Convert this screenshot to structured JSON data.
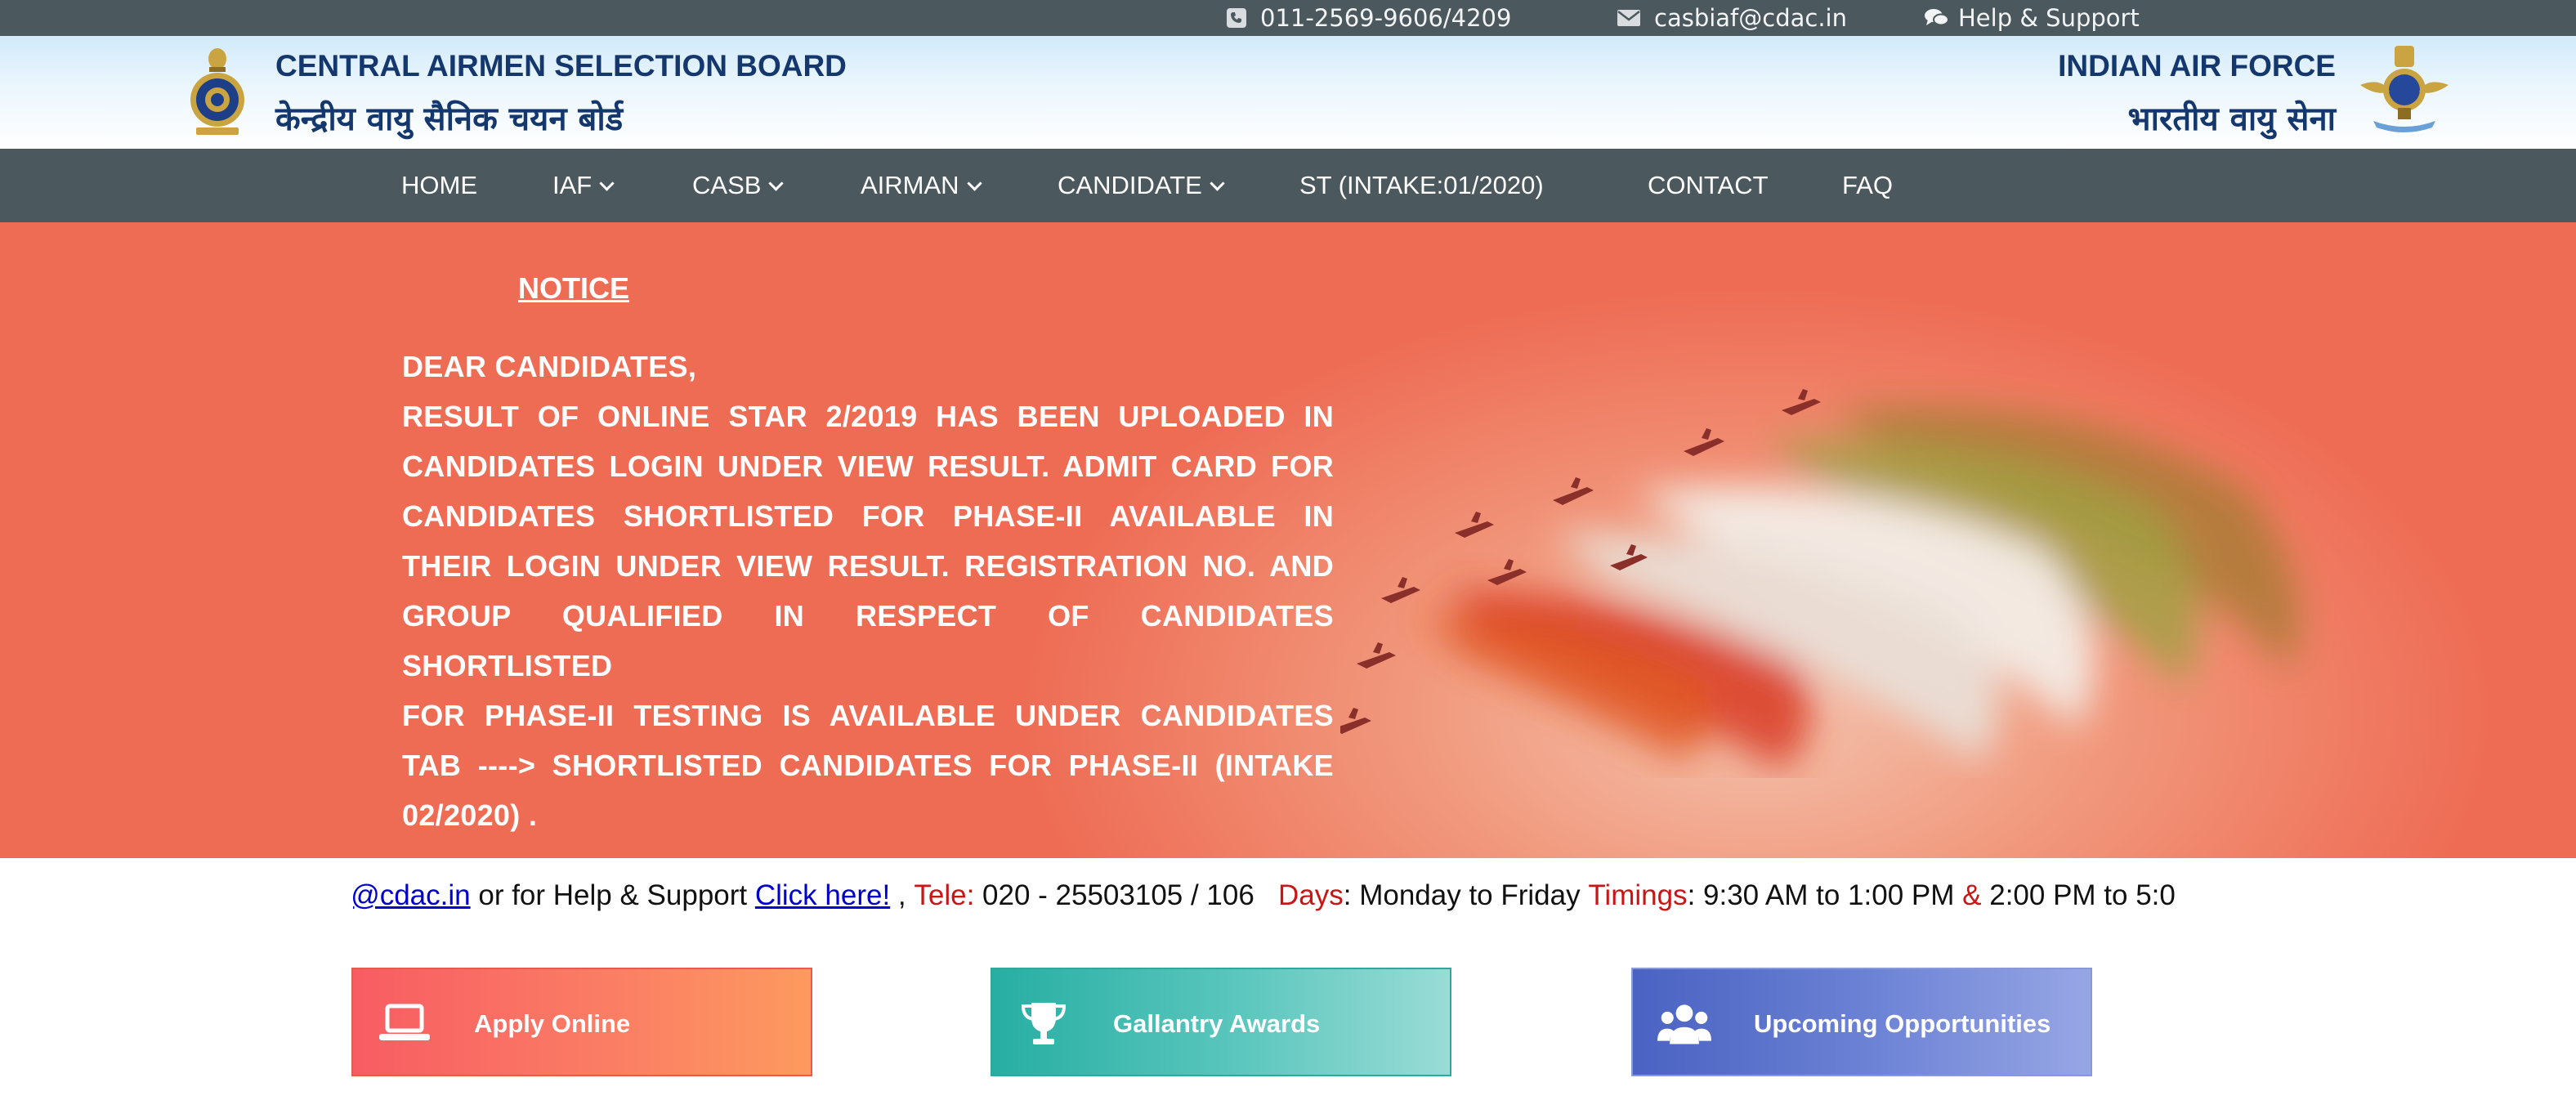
{
  "topbar": {
    "phone_icon": "phone-icon",
    "phone": "011-2569-9606/4209",
    "email_icon": "envelope-icon",
    "email": "casbiaf@cdac.in",
    "help_icon": "chat-bubbles-icon",
    "help": "Help & Support"
  },
  "header": {
    "org_en": "CENTRAL AIRMEN SELECTION BOARD",
    "org_hi": "केन्द्रीय वायु सैनिक चयन बोर्ड",
    "iaf_en": "INDIAN AIR FORCE",
    "iaf_hi": "भारतीय वायु सेना"
  },
  "nav": {
    "items": [
      {
        "label": "HOME",
        "dropdown": false
      },
      {
        "label": "IAF",
        "dropdown": true
      },
      {
        "label": "CASB",
        "dropdown": true
      },
      {
        "label": "AIRMAN",
        "dropdown": true
      },
      {
        "label": "CANDIDATE",
        "dropdown": true
      },
      {
        "label": "ST (INTAKE:01/2020)",
        "dropdown": false
      },
      {
        "label": "CONTACT",
        "dropdown": false
      },
      {
        "label": "FAQ",
        "dropdown": false
      }
    ]
  },
  "banner": {
    "notice_title": "NOTICE",
    "lines": [
      "DEAR CANDIDATES,",
      "RESULT OF ONLINE STAR 2/2019 HAS BEEN UPLOADED IN",
      "CANDIDATES LOGIN UNDER VIEW RESULT. ADMIT CARD FOR",
      "CANDIDATES SHORTLISTED FOR PHASE-II AVAILABLE IN",
      "THEIR LOGIN UNDER VIEW RESULT. REGISTRATION NO. AND",
      "GROUP QUALIFIED IN RESPECT OF CANDIDATES SHORTLISTED",
      "FOR PHASE-II TESTING IS AVAILABLE UNDER CANDIDATES",
      "TAB ----> SHORTLISTED CANDIDATES FOR PHASE-II (INTAKE",
      "02/2020) ."
    ]
  },
  "marquee": {
    "email_link": "af@cdac.in",
    "help_text": " or for Help & Support ",
    "click_link": "Click here!",
    "sep": " , ",
    "tele_label": "Tele:",
    "tele_value": " 020 - 25503105 / 106 ",
    "days_label": "Days",
    "days_value": ": Monday to Friday ",
    "timings_label": "Timings",
    "timings_value": ": 9:30 AM to 1:00 PM ",
    "amp": "&",
    "timings_value2": " 2:00 PM to 5:0"
  },
  "cards": [
    {
      "label": "Apply Online",
      "icon": "laptop-icon",
      "color": "#f85c63"
    },
    {
      "label": "Gallantry Awards",
      "icon": "trophy-icon",
      "color": "#27aea3"
    },
    {
      "label": "Upcoming Opportunities",
      "icon": "users-icon",
      "color": "#4a62c2"
    }
  ]
}
